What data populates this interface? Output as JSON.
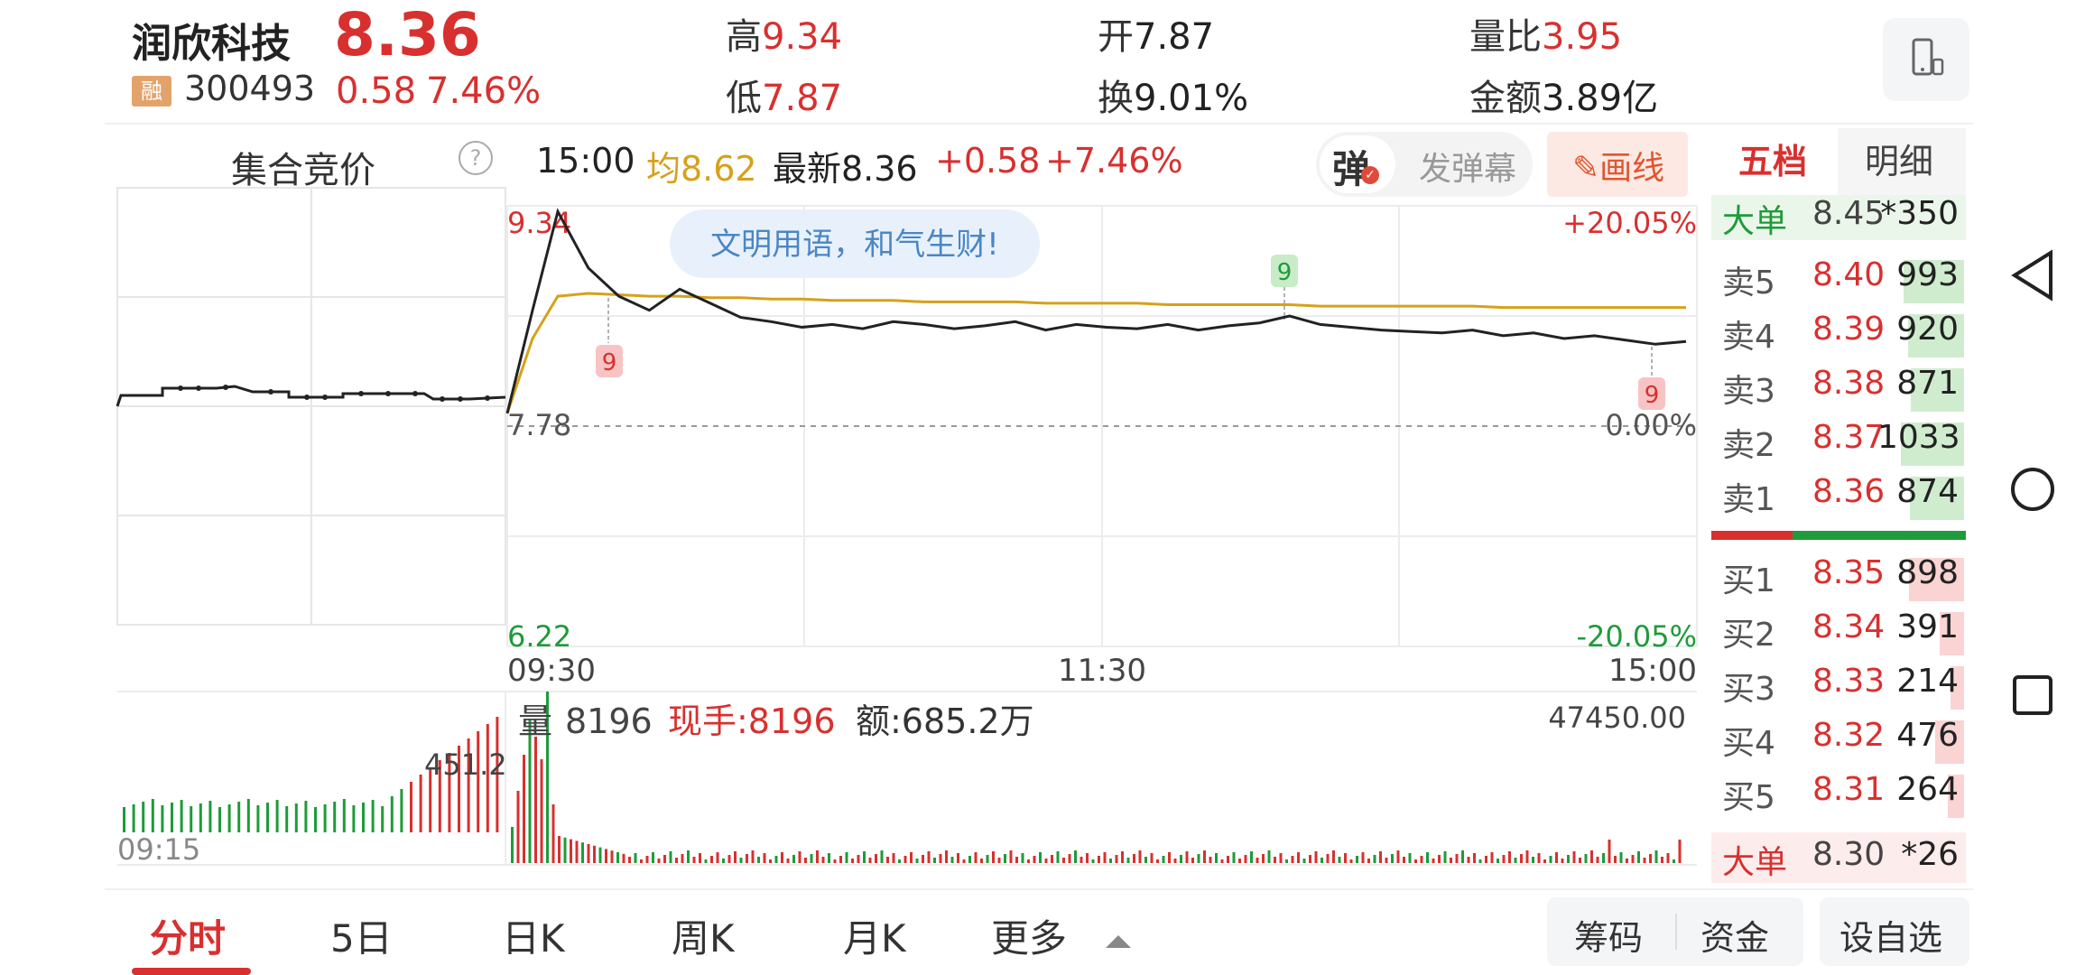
{
  "header": {
    "stock_name": "润欣科技",
    "price": "8.36",
    "badge": "融",
    "code": "300493",
    "change_abs": "0.58",
    "change_pct": "7.46%",
    "high_label": "高",
    "high_value": "9.34",
    "low_label": "低",
    "low_value": "7.87",
    "open_label": "开",
    "open_value": "7.87",
    "turnover_label": "换",
    "turnover_value": "9.01%",
    "volume_ratio_label": "量比",
    "volume_ratio_value": "3.95",
    "amount_label": "金额",
    "amount_value": "3.89亿"
  },
  "auction": {
    "title": "集合竞价",
    "help": "?",
    "vol_label": "451.2",
    "time_label": "09:15"
  },
  "chart_info": {
    "time": "15:00",
    "avg_label": "均8.62",
    "latest_label": "最新8.36",
    "change_abs": "+0.58",
    "change_pct": "+7.46%"
  },
  "danmu": {
    "icon_text": "弹",
    "send_label": "发弹幕",
    "draw_label": "画线",
    "bubble_text": "文明用语，和气生财!"
  },
  "chart_data": {
    "type": "line",
    "y_max_label": "9.34",
    "y_mid_label": "7.78",
    "y_min_label": "6.22",
    "pct_max_label": "+20.05%",
    "pct_mid_label": "0.00%",
    "pct_min_label": "-20.05%",
    "x_labels": [
      "09:30",
      "11:30",
      "15:00"
    ],
    "ylim": [
      6.22,
      9.34
    ],
    "prev_close": 7.78,
    "price_series": [
      7.87,
      8.6,
      9.3,
      8.9,
      8.7,
      8.6,
      8.75,
      8.65,
      8.55,
      8.52,
      8.48,
      8.5,
      8.47,
      8.52,
      8.5,
      8.47,
      8.49,
      8.52,
      8.46,
      8.5,
      8.48,
      8.47,
      8.5,
      8.46,
      8.49,
      8.51,
      8.56,
      8.5,
      8.48,
      8.46,
      8.45,
      8.44,
      8.46,
      8.42,
      8.44,
      8.4,
      8.42,
      8.39,
      8.36,
      8.38
    ],
    "avg_series": [
      7.87,
      8.4,
      8.7,
      8.72,
      8.71,
      8.7,
      8.7,
      8.69,
      8.69,
      8.68,
      8.68,
      8.67,
      8.67,
      8.67,
      8.66,
      8.66,
      8.66,
      8.66,
      8.65,
      8.65,
      8.65,
      8.65,
      8.64,
      8.64,
      8.64,
      8.64,
      8.64,
      8.63,
      8.63,
      8.63,
      8.63,
      8.63,
      8.63,
      8.62,
      8.62,
      8.62,
      8.62,
      8.62,
      8.62,
      8.62
    ],
    "markers": [
      "9",
      "9",
      "9"
    ],
    "volume_header": {
      "vol_label": "量",
      "vol_value": "8196",
      "now_label": "现手:8196",
      "amount_label": "额:685.2万",
      "max_label": "47450.00"
    }
  },
  "order_book": {
    "tab_active": "五档",
    "tab_other": "明细",
    "big_sell": {
      "label": "大单",
      "price": "8.45",
      "vol": "*350"
    },
    "sells": [
      {
        "label": "卖5",
        "price": "8.40",
        "vol": "993",
        "ratio": 0.96
      },
      {
        "label": "卖4",
        "price": "8.39",
        "vol": "920",
        "ratio": 0.89
      },
      {
        "label": "卖3",
        "price": "8.38",
        "vol": "871",
        "ratio": 0.84
      },
      {
        "label": "卖2",
        "price": "8.37",
        "vol": "1033",
        "ratio": 1.0
      },
      {
        "label": "卖1",
        "price": "8.36",
        "vol": "874",
        "ratio": 0.85
      }
    ],
    "buys": [
      {
        "label": "买1",
        "price": "8.35",
        "vol": "898",
        "ratio": 0.87
      },
      {
        "label": "买2",
        "price": "8.34",
        "vol": "391",
        "ratio": 0.38
      },
      {
        "label": "买3",
        "price": "8.33",
        "vol": "214",
        "ratio": 0.21
      },
      {
        "label": "买4",
        "price": "8.32",
        "vol": "476",
        "ratio": 0.46
      },
      {
        "label": "买5",
        "price": "8.31",
        "vol": "264",
        "ratio": 0.26
      }
    ],
    "big_buy": {
      "label": "大单",
      "price": "8.30",
      "vol": "*26"
    }
  },
  "bottom_tabs": {
    "fenshi": "分时",
    "five_day": "5日",
    "day_k": "日K",
    "week_k": "周K",
    "month_k": "月K",
    "more": "更多",
    "chips": "筹码",
    "funds": "资金",
    "add_watch": "设自选"
  },
  "colors": {
    "up": "#d8302f",
    "down": "#1e9b3a",
    "avg": "#d6a11b",
    "price_line": "#222222"
  }
}
